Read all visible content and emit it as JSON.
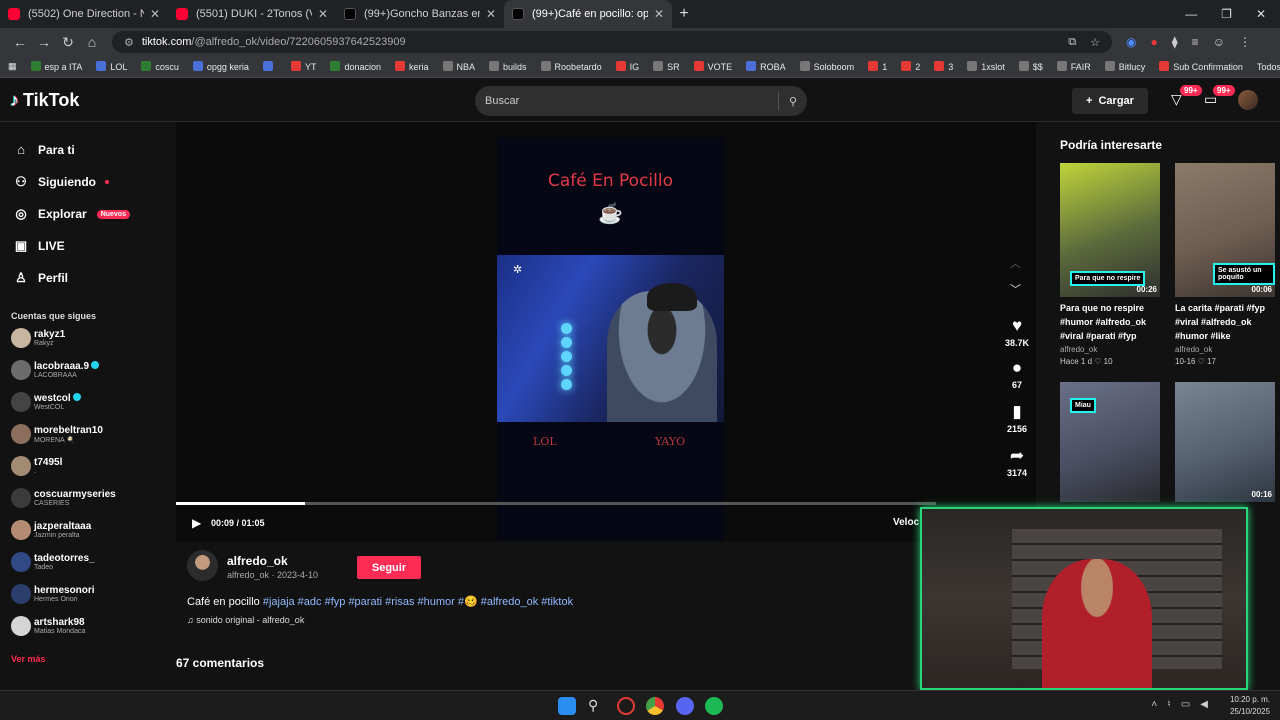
{
  "browser": {
    "tabs": [
      {
        "title": "(5502) One Direction - Night Ch",
        "type": "yt"
      },
      {
        "title": "(5501) DUKI - 2Tonos (Video Of",
        "type": "yt"
      },
      {
        "title": "(99+)Goncho Banzas en Countr",
        "type": "tt"
      },
      {
        "title": "(99+)Café en pocillo: opciones",
        "type": "tt"
      }
    ],
    "url_domain": "tiktok.com",
    "url_path": "/@alfredo_ok/video/7220605937642523909",
    "bookmarks": [
      "esp a ITA",
      "LOL",
      "coscu",
      "opgg keria",
      "",
      "YT",
      "donacion",
      "keria",
      "NBA",
      "builds",
      "Roobetardo",
      "IG",
      "SR",
      "VOTE",
      "ROBA",
      "Soloboom",
      "1",
      "2",
      "3",
      "1xslot",
      "$$",
      "FAIR",
      "Bitlucy",
      "Sub Confirmation"
    ],
    "bookmarks_all": "Todos los favoritos"
  },
  "header": {
    "logo": "TikTok",
    "search_placeholder": "Buscar",
    "upload": "Cargar",
    "badge_inbox": "99+",
    "badge_msgs": "99+"
  },
  "sidebar": {
    "nav": [
      {
        "label": "Para ti",
        "icon": "home-icon"
      },
      {
        "label": "Siguiendo",
        "icon": "users-icon"
      },
      {
        "label": "Explorar",
        "icon": "compass-icon",
        "pill": "Nuevos"
      },
      {
        "label": "LIVE",
        "icon": "live-icon"
      },
      {
        "label": "Perfil",
        "icon": "user-icon"
      }
    ],
    "following_title": "Cuentas que sigues",
    "accounts": [
      {
        "name": "rakyz1",
        "sub": "Rakyz",
        "color": "#c9b6a0"
      },
      {
        "name": "lacobraaa.9",
        "sub": "LACOBRAAA",
        "color": "#6b6b6b",
        "verified": true
      },
      {
        "name": "westcol",
        "sub": "WestCOL",
        "color": "#444",
        "verified": true
      },
      {
        "name": "morebeltran10",
        "sub": "MORENA 🍳",
        "color": "#8b6f5c"
      },
      {
        "name": "t7495l",
        "sub": ".",
        "color": "#a38a73"
      },
      {
        "name": "coscuarmyseries",
        "sub": "CASERIES",
        "color": "#3b3b3b"
      },
      {
        "name": "jazperaltaaa",
        "sub": "Jazmin peralta",
        "color": "#b48c74"
      },
      {
        "name": "tadeotorres_",
        "sub": "Tadeo",
        "color": "#314a86"
      },
      {
        "name": "hermesonori",
        "sub": "Hermes Onori",
        "color": "#2b3d6b"
      },
      {
        "name": "artshark98",
        "sub": "Matias Mondaca",
        "color": "#d5d5d5"
      }
    ],
    "see_more": "Ver más"
  },
  "video": {
    "overlay_title": "Café En Pocillo",
    "left_tag": "LOL",
    "right_tag": "YAYO",
    "time": "00:09 / 01:05",
    "progress": 0.17,
    "speed": "Veloc",
    "likes": "38.7K",
    "comments": "67",
    "saves": "2156",
    "shares": "3174"
  },
  "post": {
    "author": "alfredo_ok",
    "author_sub": "alfredo_ok · 2023-4-10",
    "follow": "Seguir",
    "desc_text": "Café en pocillo ",
    "desc_tags": "#jajaja #adc #fyp #parati #risas #humor #🥴 #alfredo_ok #tiktok",
    "sound": "♫ sonido original - alfredo_ok",
    "comments_title": "67 comentarios"
  },
  "recommended": {
    "title": "Podría interesarte",
    "items": [
      {
        "title": "Para que no respire #humor #alfredo_ok #viral #parati #fyp",
        "author": "alfredo_ok",
        "meta": "Hace 1 d",
        "likes": "10",
        "duration": "00:26",
        "overlay": "Para que no respire",
        "color": "#5c6a3c"
      },
      {
        "title": "La carita #parati #fyp #viral #alfredo_ok #humor #like",
        "author": "alfredo_ok",
        "meta": "10-16",
        "likes": "17",
        "duration": "00:06",
        "overlay": "Se asustó un poquito",
        "color": "#7c6a5a"
      },
      {
        "overlay": "Miau",
        "color": "#4a4f63"
      },
      {
        "duration": "00:16",
        "color": "#556070"
      }
    ]
  },
  "taskbar": {
    "time": "10:20 p. m.",
    "date": "25/10/2025"
  }
}
